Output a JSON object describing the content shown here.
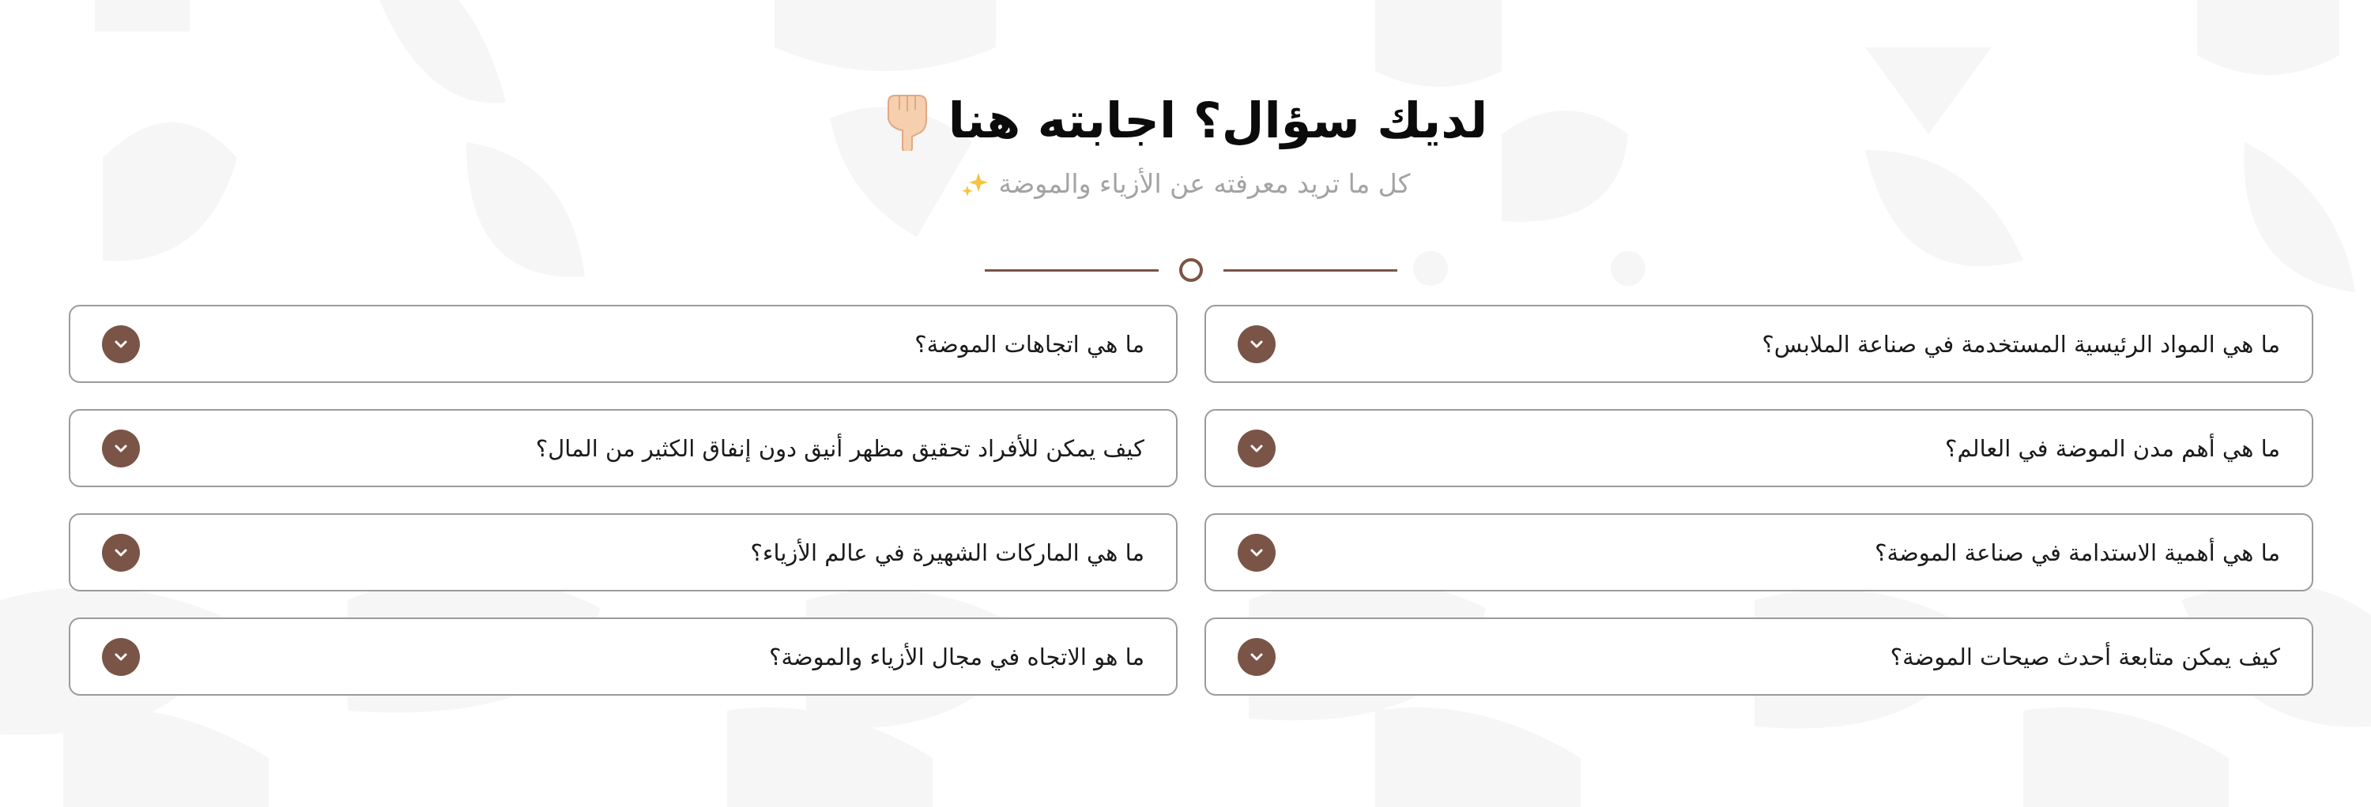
{
  "section": {
    "title": "لديك سؤال؟ اجابته هنا",
    "title_icon": "pointing-down-hand-icon",
    "subtitle": "كل ما تريد معرفته عن الأزياء والموضة",
    "subtitle_icon": "sparkles-icon"
  },
  "colors": {
    "accent": "#7a5446",
    "border": "#9b9b9b",
    "title": "#0b0b0b",
    "subtitle": "#a3a3a3"
  },
  "faq": {
    "toggle_icon": "chevron-down-icon",
    "items": [
      {
        "question": "ما هي المواد الرئيسية المستخدمة في صناعة الملابس؟"
      },
      {
        "question": "ما هي اتجاهات الموضة؟"
      },
      {
        "question": "ما هي أهم مدن الموضة في العالم؟"
      },
      {
        "question": "كيف يمكن للأفراد تحقيق مظهر أنيق دون إنفاق الكثير من المال؟"
      },
      {
        "question": "ما هي أهمية الاستدامة في صناعة الموضة؟"
      },
      {
        "question": "ما هي الماركات الشهيرة في عالم الأزياء؟"
      },
      {
        "question": "كيف يمكن متابعة أحدث صيحات الموضة؟"
      },
      {
        "question": "ما هو الاتجاه في مجال الأزياء والموضة؟"
      }
    ]
  }
}
